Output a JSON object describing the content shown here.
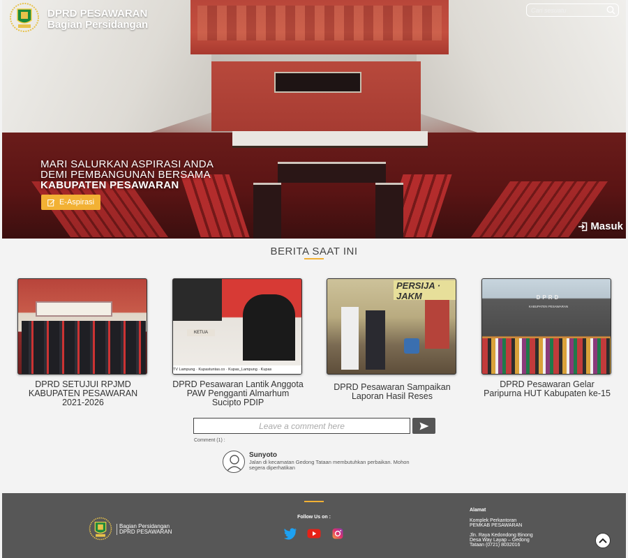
{
  "header": {
    "brand_line1": "DPRD PESAWARAN",
    "brand_line2": "Bagian Persidangan",
    "search_placeholder": "Cari sesuatu"
  },
  "hero": {
    "tagline_line1": "MARI SALURKAN ASPIRASI ANDA",
    "tagline_line2": "DEMI PEMBANGUNAN BERSAMA",
    "tagline_line3": "KABUPATEN PESAWARAN",
    "cta_label": "E-Aspirasi",
    "login_label": "Masuk"
  },
  "news": {
    "title": "BERITA SAAT INI",
    "items": [
      {
        "caption": "DPRD SETUJUI RPJMD KABUPATEN PESAWARAN 2021-2026"
      },
      {
        "caption": "DPRD Pesawaran Lantik Anggota PAW Pengganti Almarhum Sucipto PDIP",
        "watermark": "TV Lampung · Kupastuntas.co · Kupas_Lampung · Kupas",
        "placard": "KETUA"
      },
      {
        "caption": "DPRD Pesawaran Sampaikan Laporan Hasil Reses",
        "sign_text": "PERSIJA · JAKM"
      },
      {
        "caption": "DPRD Pesawaran Gelar Paripurna HUT Kabupaten ke-15",
        "sign_text": "DPRD",
        "sign_sub": "KABUPATEN PESAWARAN"
      }
    ]
  },
  "comments": {
    "input_placeholder": "Leave a comment here",
    "count_label": "Comment (1) :",
    "items": [
      {
        "name": "Sunyoto",
        "text": "Jalan di kecamatan Gedong Tataan membutuhkan perbaikan. Mohon segera diperhatikan"
      }
    ]
  },
  "footer": {
    "brand_line1": "Bagian Persidangan",
    "brand_line2": "DPRD PESAWARAN",
    "follow_label": "Follow Us on :",
    "social_icons": [
      "twitter-icon",
      "youtube-icon",
      "instagram-icon"
    ],
    "address_title": "Alamat",
    "address_line1": "Komplek Perkantoran",
    "address_line2": "PEMKAB PESAWARAN",
    "address_line3": "Jln. Raya Kedondong Binong",
    "address_line4": "Desa Way Layap – Gedong",
    "address_line5": "Tataan (0721) 8032016"
  },
  "colors": {
    "accent": "#f2b134",
    "footer_bg": "#575757",
    "twitter": "#1da1f2",
    "youtube": "#e62117"
  }
}
